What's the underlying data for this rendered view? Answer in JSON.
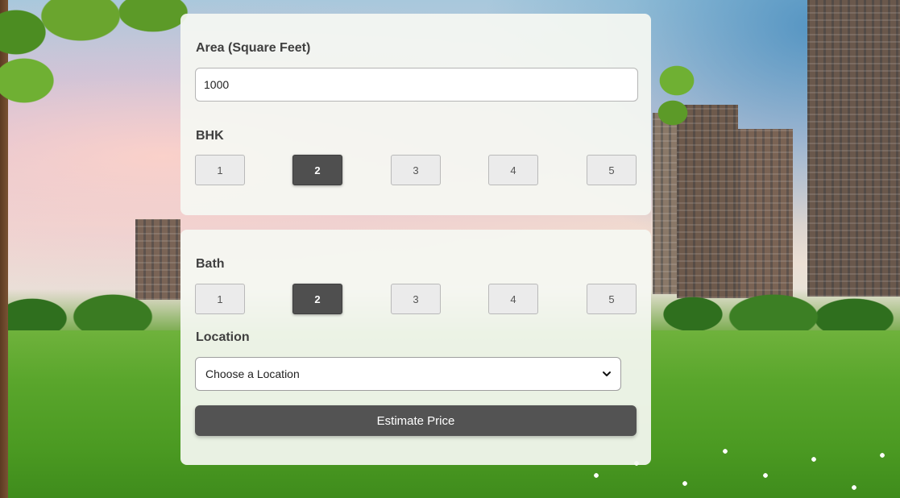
{
  "form": {
    "area": {
      "label": "Area (Square Feet)",
      "value": "1000"
    },
    "bhk": {
      "label": "BHK",
      "options": [
        "1",
        "2",
        "3",
        "4",
        "5"
      ],
      "selected": "2"
    },
    "bath": {
      "label": "Bath",
      "options": [
        "1",
        "2",
        "3",
        "4",
        "5"
      ],
      "selected": "2"
    },
    "location": {
      "label": "Location",
      "selected_text": "Choose a Location",
      "icon": "chevron-down-icon"
    },
    "submit_label": "Estimate Price"
  },
  "colors": {
    "active_button": "#4f4f4f",
    "inactive_button": "#ebebeb",
    "primary_button": "#535353",
    "card_background": "#f5f7f2"
  }
}
